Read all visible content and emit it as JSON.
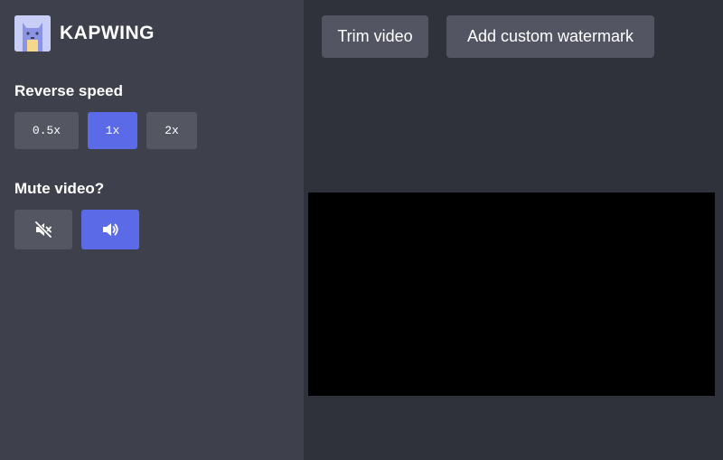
{
  "brand": {
    "name": "KAPWING",
    "logo_icon": "cat-logo-icon"
  },
  "reverse_speed": {
    "label": "Reverse speed",
    "options": [
      "0.5x",
      "1x",
      "2x"
    ],
    "selected": "1x"
  },
  "mute": {
    "label": "Mute video?",
    "options": [
      {
        "icon": "volume-mute-icon",
        "selected": false
      },
      {
        "icon": "volume-on-icon",
        "selected": true
      }
    ]
  },
  "toolbar": {
    "trim_label": "Trim video",
    "watermark_label": "Add custom watermark"
  },
  "colors": {
    "accent": "#5b6ae6",
    "sidebar": "#3e414b",
    "background": "#2f323b",
    "button": "#545762"
  }
}
